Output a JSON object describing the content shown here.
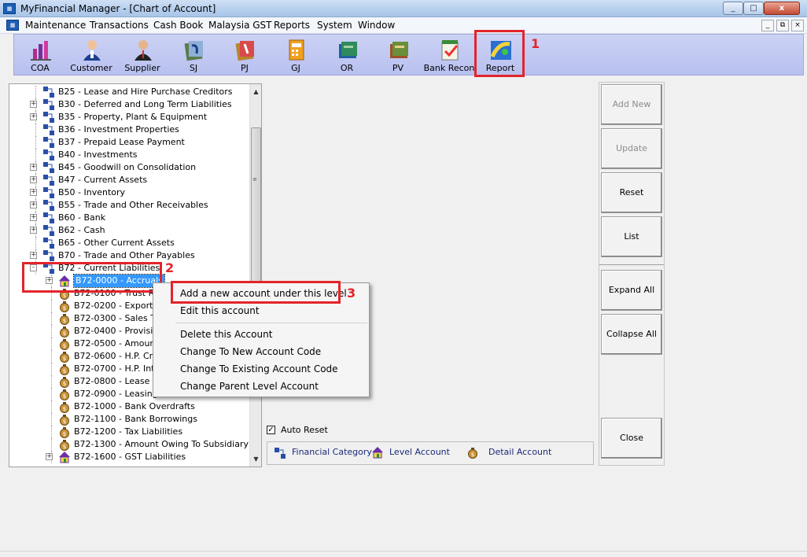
{
  "window": {
    "title": "MyFinancial Manager - [Chart of Account]",
    "min": "_",
    "max": "□",
    "close": "x"
  },
  "menu": [
    "Maintenance",
    "Transactions",
    "Cash Book",
    "Malaysia GST",
    "Reports",
    "System",
    "Window"
  ],
  "mdi": {
    "min": "_",
    "restore": "⧉",
    "close": "×"
  },
  "toolbar": [
    {
      "label": "COA",
      "icon": "coa-chart-icon"
    },
    {
      "label": "Customer",
      "icon": "customer-icon"
    },
    {
      "label": "Supplier",
      "icon": "supplier-icon"
    },
    {
      "label": "SJ",
      "icon": "sales-journal-icon"
    },
    {
      "label": "PJ",
      "icon": "purchase-journal-icon"
    },
    {
      "label": "GJ",
      "icon": "general-journal-icon"
    },
    {
      "label": "OR",
      "icon": "official-receipt-icon"
    },
    {
      "label": "PV",
      "icon": "payment-voucher-icon"
    },
    {
      "label": "Bank Recon",
      "icon": "bank-recon-icon"
    },
    {
      "label": "Report",
      "icon": "report-icon"
    }
  ],
  "annotations": {
    "one": "1",
    "two": "2",
    "three": "3"
  },
  "tree": [
    {
      "label": "B25 - Lease and Hire Purchase Creditors",
      "level": 0,
      "expander": ""
    },
    {
      "label": "B30 - Deferred and Long Term Liabilities",
      "level": 0,
      "expander": "+"
    },
    {
      "label": "B35 - Property, Plant & Equipment",
      "level": 0,
      "expander": "+"
    },
    {
      "label": "B36 - Investment Properties",
      "level": 0,
      "expander": ""
    },
    {
      "label": "B37 - Prepaid Lease Payment",
      "level": 0,
      "expander": ""
    },
    {
      "label": "B40 - Investments",
      "level": 0,
      "expander": ""
    },
    {
      "label": "B45 - Goodwill on Consolidation",
      "level": 0,
      "expander": "+"
    },
    {
      "label": "B47 - Current Assets",
      "level": 0,
      "expander": "+"
    },
    {
      "label": "B50 - Inventory",
      "level": 0,
      "expander": "+"
    },
    {
      "label": "B55 - Trade and Other Receivables",
      "level": 0,
      "expander": "+"
    },
    {
      "label": "B60 - Bank",
      "level": 0,
      "expander": "+"
    },
    {
      "label": "B62 - Cash",
      "level": 0,
      "expander": "+"
    },
    {
      "label": "B65 - Other Current Assets",
      "level": 0,
      "expander": ""
    },
    {
      "label": "B70 - Trade and Other Payables",
      "level": 0,
      "expander": "+"
    },
    {
      "label": "B72 - Current Liabilities",
      "level": 0,
      "expander": "-"
    },
    {
      "label": "B72-0000 - Accruals",
      "level": 1,
      "expander": "+",
      "type": "level",
      "selected": true
    },
    {
      "label": "B72-0100 - Trust Re",
      "level": 1,
      "expander": "",
      "type": "detail"
    },
    {
      "label": "B72-0200 - Export Cr",
      "level": 1,
      "expander": "",
      "type": "detail"
    },
    {
      "label": "B72-0300 - Sales Ta",
      "level": 1,
      "expander": "",
      "type": "detail"
    },
    {
      "label": "B72-0400 - Provision",
      "level": 1,
      "expander": "",
      "type": "detail"
    },
    {
      "label": "B72-0500 - Amount D",
      "level": 1,
      "expander": "",
      "type": "detail"
    },
    {
      "label": "B72-0600 - H.P. Cred",
      "level": 1,
      "expander": "",
      "type": "detail"
    },
    {
      "label": "B72-0700 - H.P. Inter",
      "level": 1,
      "expander": "",
      "type": "detail"
    },
    {
      "label": "B72-0800 - Lease Cr",
      "level": 1,
      "expander": "",
      "type": "detail"
    },
    {
      "label": "B72-0900 - Leasing I",
      "level": 1,
      "expander": "",
      "type": "detail"
    },
    {
      "label": "B72-1000 - Bank Overdrafts",
      "level": 1,
      "expander": "",
      "type": "detail"
    },
    {
      "label": "B72-1100 - Bank Borrowings",
      "level": 1,
      "expander": "",
      "type": "detail"
    },
    {
      "label": "B72-1200 - Tax Liabilities",
      "level": 1,
      "expander": "",
      "type": "detail"
    },
    {
      "label": "B72-1300 - Amount Owing To Subsidiary",
      "level": 1,
      "expander": "",
      "type": "detail"
    },
    {
      "label": "B72-1600 - GST Liabilities",
      "level": 1,
      "expander": "+",
      "type": "level"
    }
  ],
  "context_menu": {
    "add": "Add a new account under this level",
    "edit": "Edit this account",
    "delete": "Delete this Account",
    "change_new": "Change To New Account Code",
    "change_existing": "Change To Existing Account Code",
    "change_parent": "Change Parent Level Account"
  },
  "buttons": {
    "add_new": "Add New",
    "update": "Update",
    "reset": "Reset",
    "list": "List",
    "expand_all": "Expand All",
    "collapse_all": "Collapse All",
    "close": "Close"
  },
  "auto_reset": {
    "label": "Auto Reset",
    "checked": true,
    "mark": "✓"
  },
  "legend": {
    "financial_category": "Financial Category",
    "level_account": "Level Account",
    "detail_account": "Detail Account"
  },
  "colors": {
    "annotation": "#e3242b",
    "selection": "#3399ff",
    "toolbar": "#c4caf3"
  }
}
